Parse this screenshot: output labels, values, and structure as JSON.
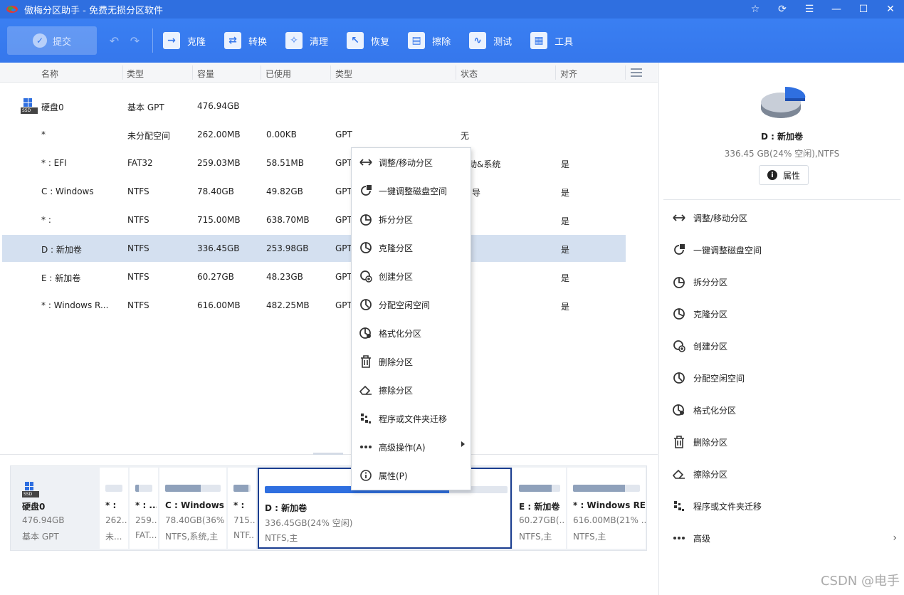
{
  "app": {
    "title": "傲梅分区助手 - 免费无损分区软件"
  },
  "toolbar": {
    "submit": "提交",
    "tools": [
      {
        "label": "克隆",
        "icon": "clone-icon"
      },
      {
        "label": "转换",
        "icon": "convert-icon"
      },
      {
        "label": "清理",
        "icon": "clean-icon"
      },
      {
        "label": "恢复",
        "icon": "restore-icon"
      },
      {
        "label": "擦除",
        "icon": "wipe-icon"
      },
      {
        "label": "测试",
        "icon": "test-icon"
      },
      {
        "label": "工具",
        "icon": "tools-icon"
      }
    ]
  },
  "columns": [
    "名称",
    "类型",
    "容量",
    "已使用",
    "类型",
    "状态",
    "对齐"
  ],
  "rows": [
    {
      "name": "硬盘0",
      "type": "基本 GPT",
      "capacity": "476.94GB",
      "used": "",
      "ptype": "",
      "status": "",
      "align": ""
    },
    {
      "name": "*",
      "type": "未分配空间",
      "capacity": "262.00MB",
      "used": "0.00KB",
      "ptype": "GPT",
      "status": "无",
      "align": ""
    },
    {
      "name": "* : EFI",
      "type": "FAT32",
      "capacity": "259.03MB",
      "used": "58.51MB",
      "ptype": "GPT",
      "status": "动&系统",
      "align": "是"
    },
    {
      "name": "C : Windows",
      "type": "NTFS",
      "capacity": "78.40GB",
      "used": "49.82GB",
      "ptype": "GPT",
      "status": "导",
      "align": "是"
    },
    {
      "name": "* :",
      "type": "NTFS",
      "capacity": "715.00MB",
      "used": "638.70MB",
      "ptype": "GPT",
      "status": "",
      "align": "是"
    },
    {
      "name": "D : 新加卷",
      "type": "NTFS",
      "capacity": "336.45GB",
      "used": "253.98GB",
      "ptype": "GPT",
      "status": "",
      "align": "是"
    },
    {
      "name": "E : 新加卷",
      "type": "NTFS",
      "capacity": "60.27GB",
      "used": "48.23GB",
      "ptype": "GPT",
      "status": "",
      "align": "是"
    },
    {
      "name": "* : Windows R...",
      "type": "NTFS",
      "capacity": "616.00MB",
      "used": "482.25MB",
      "ptype": "GPT",
      "status": "",
      "align": "是"
    }
  ],
  "diskmap": {
    "disk": {
      "name": "硬盘0",
      "size": "476.94GB",
      "type": "基本 GPT"
    },
    "parts": [
      {
        "name": "* :",
        "size": "262...",
        "fs": "未...",
        "used_fraction": 0.0
      },
      {
        "name": "* : ...",
        "size": "259...",
        "fs": "FAT...",
        "used_fraction": 0.22
      },
      {
        "name": "C : Windows",
        "size": "78.40GB(36%...",
        "fs": "NTFS,系统,主",
        "used_fraction": 0.64
      },
      {
        "name": "* :",
        "size": "715...",
        "fs": "NTF...",
        "used_fraction": 0.89
      },
      {
        "name": "D : 新加卷",
        "size": "336.45GB(24% 空闲)",
        "fs": "NTFS,主",
        "used_fraction": 0.76
      },
      {
        "name": "E : 新加卷",
        "size": "60.27GB(...",
        "fs": "NTFS,主",
        "used_fraction": 0.8
      },
      {
        "name": "* : Windows RE...",
        "size": "616.00MB(21% ...",
        "fs": "NTFS,主",
        "used_fraction": 0.78
      }
    ]
  },
  "context_menu": [
    {
      "label": "调整/移动分区",
      "icon": "resize-move-icon"
    },
    {
      "label": "一键调整磁盘空间",
      "icon": "quick-adjust-icon"
    },
    {
      "label": "拆分分区",
      "icon": "split-icon"
    },
    {
      "label": "克隆分区",
      "icon": "clone-partition-icon"
    },
    {
      "label": "创建分区",
      "icon": "create-icon"
    },
    {
      "label": "分配空闲空间",
      "icon": "allocate-icon"
    },
    {
      "label": "格式化分区",
      "icon": "format-icon"
    },
    {
      "label": "删除分区",
      "icon": "delete-icon"
    },
    {
      "label": "擦除分区",
      "icon": "erase-icon"
    },
    {
      "label": "程序或文件夹迁移",
      "icon": "migrate-icon"
    },
    {
      "label": "高级操作(A)",
      "icon": "more-icon",
      "submenu": true
    },
    {
      "label": "属性(P)",
      "icon": "info-icon"
    }
  ],
  "right_panel": {
    "name": "D : 新加卷",
    "info": "336.45 GB(24% 空闲),NTFS",
    "properties": "属性",
    "actions": [
      {
        "label": "调整/移动分区",
        "icon": "resize-move-icon"
      },
      {
        "label": "一键调整磁盘空间",
        "icon": "quick-adjust-icon"
      },
      {
        "label": "拆分分区",
        "icon": "split-icon"
      },
      {
        "label": "克隆分区",
        "icon": "clone-partition-icon"
      },
      {
        "label": "创建分区",
        "icon": "create-icon"
      },
      {
        "label": "分配空闲空间",
        "icon": "allocate-icon"
      },
      {
        "label": "格式化分区",
        "icon": "format-icon"
      },
      {
        "label": "删除分区",
        "icon": "delete-icon"
      },
      {
        "label": "擦除分区",
        "icon": "erase-icon"
      },
      {
        "label": "程序或文件夹迁移",
        "icon": "migrate-icon"
      },
      {
        "label": "高级",
        "icon": "more-icon",
        "submenu": true
      }
    ]
  },
  "watermark": "CSDN @电手",
  "colors": {
    "accent": "#2f6fe0",
    "selected_row": "#d4e0f0",
    "titlebar": "#2f6fe0"
  }
}
